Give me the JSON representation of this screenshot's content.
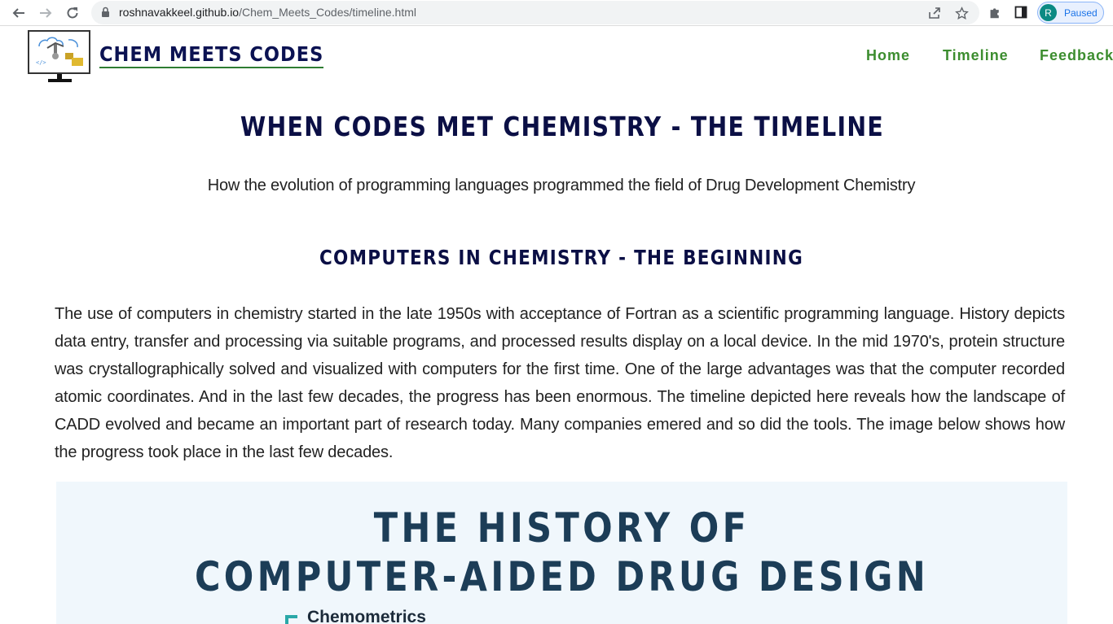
{
  "browser": {
    "url_host": "roshnavakkeel.github.io",
    "url_path": "/Chem_Meets_Codes/timeline.html",
    "profile_initial": "R",
    "profile_status": "Paused",
    "accent": "#1a73e8"
  },
  "site": {
    "brand": "CHEM MEETS CODES",
    "nav": [
      "Home",
      "Timeline",
      "Feedback"
    ],
    "nav_color": "#3c8d2f",
    "heading_color": "#0b0f45"
  },
  "main": {
    "title": "WHEN CODES MET CHEMISTRY - THE TIMELINE",
    "subtitle": "How the evolution of programming languages programmed the field of Drug Development Chemistry",
    "section_title": "COMPUTERS IN CHEMISTRY - THE BEGINNING",
    "paragraph": "The use of computers in chemistry started in the late 1950s with acceptance of Fortran as a scientific programming language. History depicts data entry, transfer and processing via suitable programs, and processed results display on a local device. In the mid 1970's, protein structure was crystallographically solved and visualized with computers for the first time. One of the large advantages was that the computer recorded atomic coordinates. And in the last few decades, the progress has been enormous. The timeline depicted here reveals how the landscape of CADD evolved and became an important part of research today. Many companies emered and so did the tools. The image below shows how the progress took place in the last few decades."
  },
  "infographic": {
    "title_line1": "THE HISTORY OF",
    "title_line2": "COMPUTER-AIDED DRUG DESIGN",
    "first_item": "Chemometrics"
  }
}
